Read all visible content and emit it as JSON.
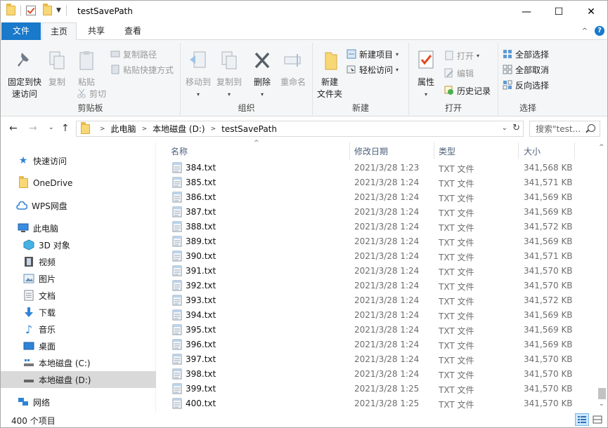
{
  "window": {
    "title": "testSavePath",
    "minimize": "—",
    "maximize": "☐",
    "close": "✕"
  },
  "ribbon_tabs": {
    "file": "文件",
    "home": "主页",
    "share": "共享",
    "view": "查看"
  },
  "ribbon": {
    "clipboard": {
      "label": "剪贴板",
      "pin_line1": "固定到快",
      "pin_line2": "速访问",
      "copy": "复制",
      "paste": "粘贴",
      "copy_path": "复制路径",
      "paste_shortcut": "粘贴快捷方式",
      "cut": "剪切"
    },
    "organize": {
      "label": "组织",
      "move_to": "移动到",
      "copy_to": "复制到",
      "delete": "删除",
      "rename": "重命名"
    },
    "new": {
      "label": "新建",
      "new_folder_line1": "新建",
      "new_folder_line2": "文件夹",
      "new_item": "新建项目",
      "easy_access": "轻松访问"
    },
    "open": {
      "label": "打开",
      "properties": "属性",
      "open": "打开",
      "edit": "编辑",
      "history": "历史记录"
    },
    "select": {
      "label": "选择",
      "select_all": "全部选择",
      "select_none": "全部取消",
      "invert": "反向选择"
    }
  },
  "address": {
    "crumbs": [
      "此电脑",
      "本地磁盘 (D:)",
      "testSavePath"
    ],
    "search_placeholder": "搜索\"test..."
  },
  "nav": {
    "quick_access": "快速访问",
    "onedrive": "OneDrive",
    "wps": "WPS网盘",
    "this_pc": "此电脑",
    "objects3d": "3D 对象",
    "videos": "视频",
    "pictures": "图片",
    "documents": "文档",
    "downloads": "下载",
    "music": "音乐",
    "desktop": "桌面",
    "drive_c": "本地磁盘 (C:)",
    "drive_d": "本地磁盘 (D:)",
    "network": "网络"
  },
  "columns": {
    "name": "名称",
    "date": "修改日期",
    "type": "类型",
    "size": "大小"
  },
  "files": [
    {
      "name": "384.txt",
      "date": "2021/3/28 1:23",
      "type": "TXT 文件",
      "size": "341,568 KB"
    },
    {
      "name": "385.txt",
      "date": "2021/3/28 1:24",
      "type": "TXT 文件",
      "size": "341,571 KB"
    },
    {
      "name": "386.txt",
      "date": "2021/3/28 1:24",
      "type": "TXT 文件",
      "size": "341,569 KB"
    },
    {
      "name": "387.txt",
      "date": "2021/3/28 1:24",
      "type": "TXT 文件",
      "size": "341,569 KB"
    },
    {
      "name": "388.txt",
      "date": "2021/3/28 1:24",
      "type": "TXT 文件",
      "size": "341,572 KB"
    },
    {
      "name": "389.txt",
      "date": "2021/3/28 1:24",
      "type": "TXT 文件",
      "size": "341,569 KB"
    },
    {
      "name": "390.txt",
      "date": "2021/3/28 1:24",
      "type": "TXT 文件",
      "size": "341,571 KB"
    },
    {
      "name": "391.txt",
      "date": "2021/3/28 1:24",
      "type": "TXT 文件",
      "size": "341,570 KB"
    },
    {
      "name": "392.txt",
      "date": "2021/3/28 1:24",
      "type": "TXT 文件",
      "size": "341,570 KB"
    },
    {
      "name": "393.txt",
      "date": "2021/3/28 1:24",
      "type": "TXT 文件",
      "size": "341,572 KB"
    },
    {
      "name": "394.txt",
      "date": "2021/3/28 1:24",
      "type": "TXT 文件",
      "size": "341,569 KB"
    },
    {
      "name": "395.txt",
      "date": "2021/3/28 1:24",
      "type": "TXT 文件",
      "size": "341,569 KB"
    },
    {
      "name": "396.txt",
      "date": "2021/3/28 1:24",
      "type": "TXT 文件",
      "size": "341,569 KB"
    },
    {
      "name": "397.txt",
      "date": "2021/3/28 1:24",
      "type": "TXT 文件",
      "size": "341,570 KB"
    },
    {
      "name": "398.txt",
      "date": "2021/3/28 1:24",
      "type": "TXT 文件",
      "size": "341,570 KB"
    },
    {
      "name": "399.txt",
      "date": "2021/3/28 1:25",
      "type": "TXT 文件",
      "size": "341,570 KB"
    },
    {
      "name": "400.txt",
      "date": "2021/3/28 1:25",
      "type": "TXT 文件",
      "size": "341,570 KB"
    }
  ],
  "status": {
    "count": "400 个项目"
  },
  "colors": {
    "accent": "#1979ca",
    "folder": "#f8d775",
    "selected_nav": "#d9d9d9"
  }
}
